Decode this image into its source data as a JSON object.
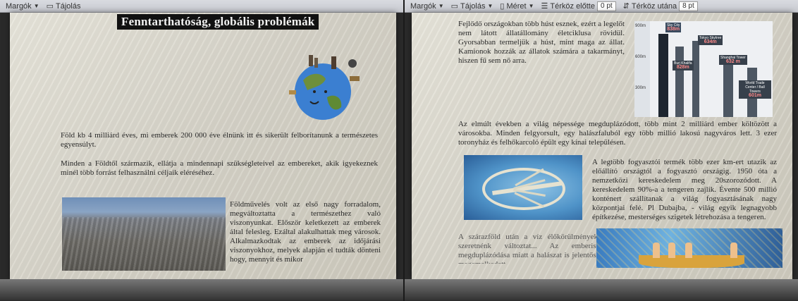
{
  "left": {
    "ribbon": {
      "margins_label": "Margók",
      "orientation_label": "Tájolás"
    },
    "title": "Fenntarthatóság, globális problémák",
    "paragraphs": [
      "Föld kb 4 milliárd éves, mi emberek 200 000 éve élnünk itt és sikerült felborítanunk a természetes egyensúlyt.",
      "Minden a Földtől származik, ellátja a mindennapi szükségleteivel az embereket, akik igyekeznek minél több forrást felhasználni céljaik eléréséhez.",
      "Földművelés volt az első nagy forradalom, megváltoztatta a természethez való viszonyunkat. Először keletkezett az emberek által felesleg. Ezáltal alakulhattak meg városok. Alkalmazkodtak az emberek az időjárási viszonyokhoz, melyek alapján el tudták dönteni hogy, mennyit és mikor"
    ]
  },
  "right": {
    "ribbon": {
      "margins_label": "Margók",
      "orientation_label": "Tájolás",
      "size_label": "Méret",
      "spacing_before_label": "Térköz előtte",
      "spacing_before_value": "0 pt",
      "spacing_after_label": "Térköz utána",
      "spacing_after_value": "8 pt"
    },
    "paragraphs": [
      "Fejlődő országokban több húst esznek, ezért a legelőt nem látott állatállomány életciklusa rövidül. Gyorsabban termeljük a húst, mint maga az állat. Kamionok hozzák az állatok számára a takarmányt, hiszen fű sem nő arra.",
      "Az elmúlt években a világ népessége megduplázódott, több mint 2 milliárd ember költözött a városokba. Minden felgyorsult, egy halászfaluból egy több millió lakosú nagyváros lett. 3 ezer toronyház és felhőkarcoló épült egy kínai településen.",
      "A legtöbb fogyasztói termék több ezer km-ert utazik az előállító országtól a fogyasztó országig. 1950 óta a nemzetközi kereskedelem meg 20szorozódott. A kereskedelem 90%-a a tengeren zajlik. Évente 500 millió konténert szállítanak a világ fogyasztásának nagy központjai felé. Pl Dubajba, - világ egyik legnagyobb építkezése, mesterséges szigetek létrehozása a tengeren.",
      "A szárazföld után a víz élőkörülményeket szeretnénk változtat... Az emberiség megduplázódása miatt a halászat is jelentősen megemelkedett."
    ],
    "skyline": {
      "axis": [
        "900m",
        "600m",
        "300m"
      ],
      "towers": [
        {
          "name": "Sky City",
          "height": "838m"
        },
        {
          "name": "Burj Khalifa",
          "height": "828m"
        },
        {
          "name": "Tokyo Skytree",
          "height": "634m"
        },
        {
          "name": "Shanghai Tower",
          "height": "632 m"
        },
        {
          "name": "World Trade Center / Ball Towers",
          "height": "601m"
        }
      ]
    }
  }
}
